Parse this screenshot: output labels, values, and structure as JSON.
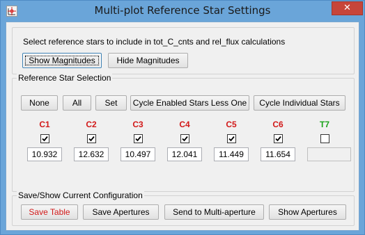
{
  "window": {
    "title": "Multi-plot Reference Star Settings",
    "close_glyph": "✕"
  },
  "magnitudes": {
    "instruction": "Select reference stars to include in tot_C_cnts and rel_flux calculations",
    "show_label": "Show Magnitudes",
    "hide_label": "Hide Magnitudes"
  },
  "selection": {
    "title": "Reference Star Selection",
    "buttons": {
      "none": "None",
      "all": "All",
      "set": "Set",
      "cycle_enabled": "Cycle Enabled Stars Less One",
      "cycle_individual": "Cycle Individual Stars"
    },
    "stars": [
      {
        "label": "C1",
        "checked": true,
        "magnitude": "10.932",
        "color": "#d21919"
      },
      {
        "label": "C2",
        "checked": true,
        "magnitude": "12.632",
        "color": "#d21919"
      },
      {
        "label": "C3",
        "checked": true,
        "magnitude": "10.497",
        "color": "#d21919"
      },
      {
        "label": "C4",
        "checked": true,
        "magnitude": "12.041",
        "color": "#d21919"
      },
      {
        "label": "C5",
        "checked": true,
        "magnitude": "11.449",
        "color": "#d21919"
      },
      {
        "label": "C6",
        "checked": true,
        "magnitude": "11.654",
        "color": "#d21919"
      },
      {
        "label": "T7",
        "checked": false,
        "magnitude": "",
        "color": "#1aa31a"
      }
    ]
  },
  "config": {
    "title": "Save/Show Current Configuration",
    "save_table": "Save Table",
    "save_apertures": "Save Apertures",
    "send_multi": "Send to Multi-aperture",
    "show_apertures": "Show Apertures"
  }
}
